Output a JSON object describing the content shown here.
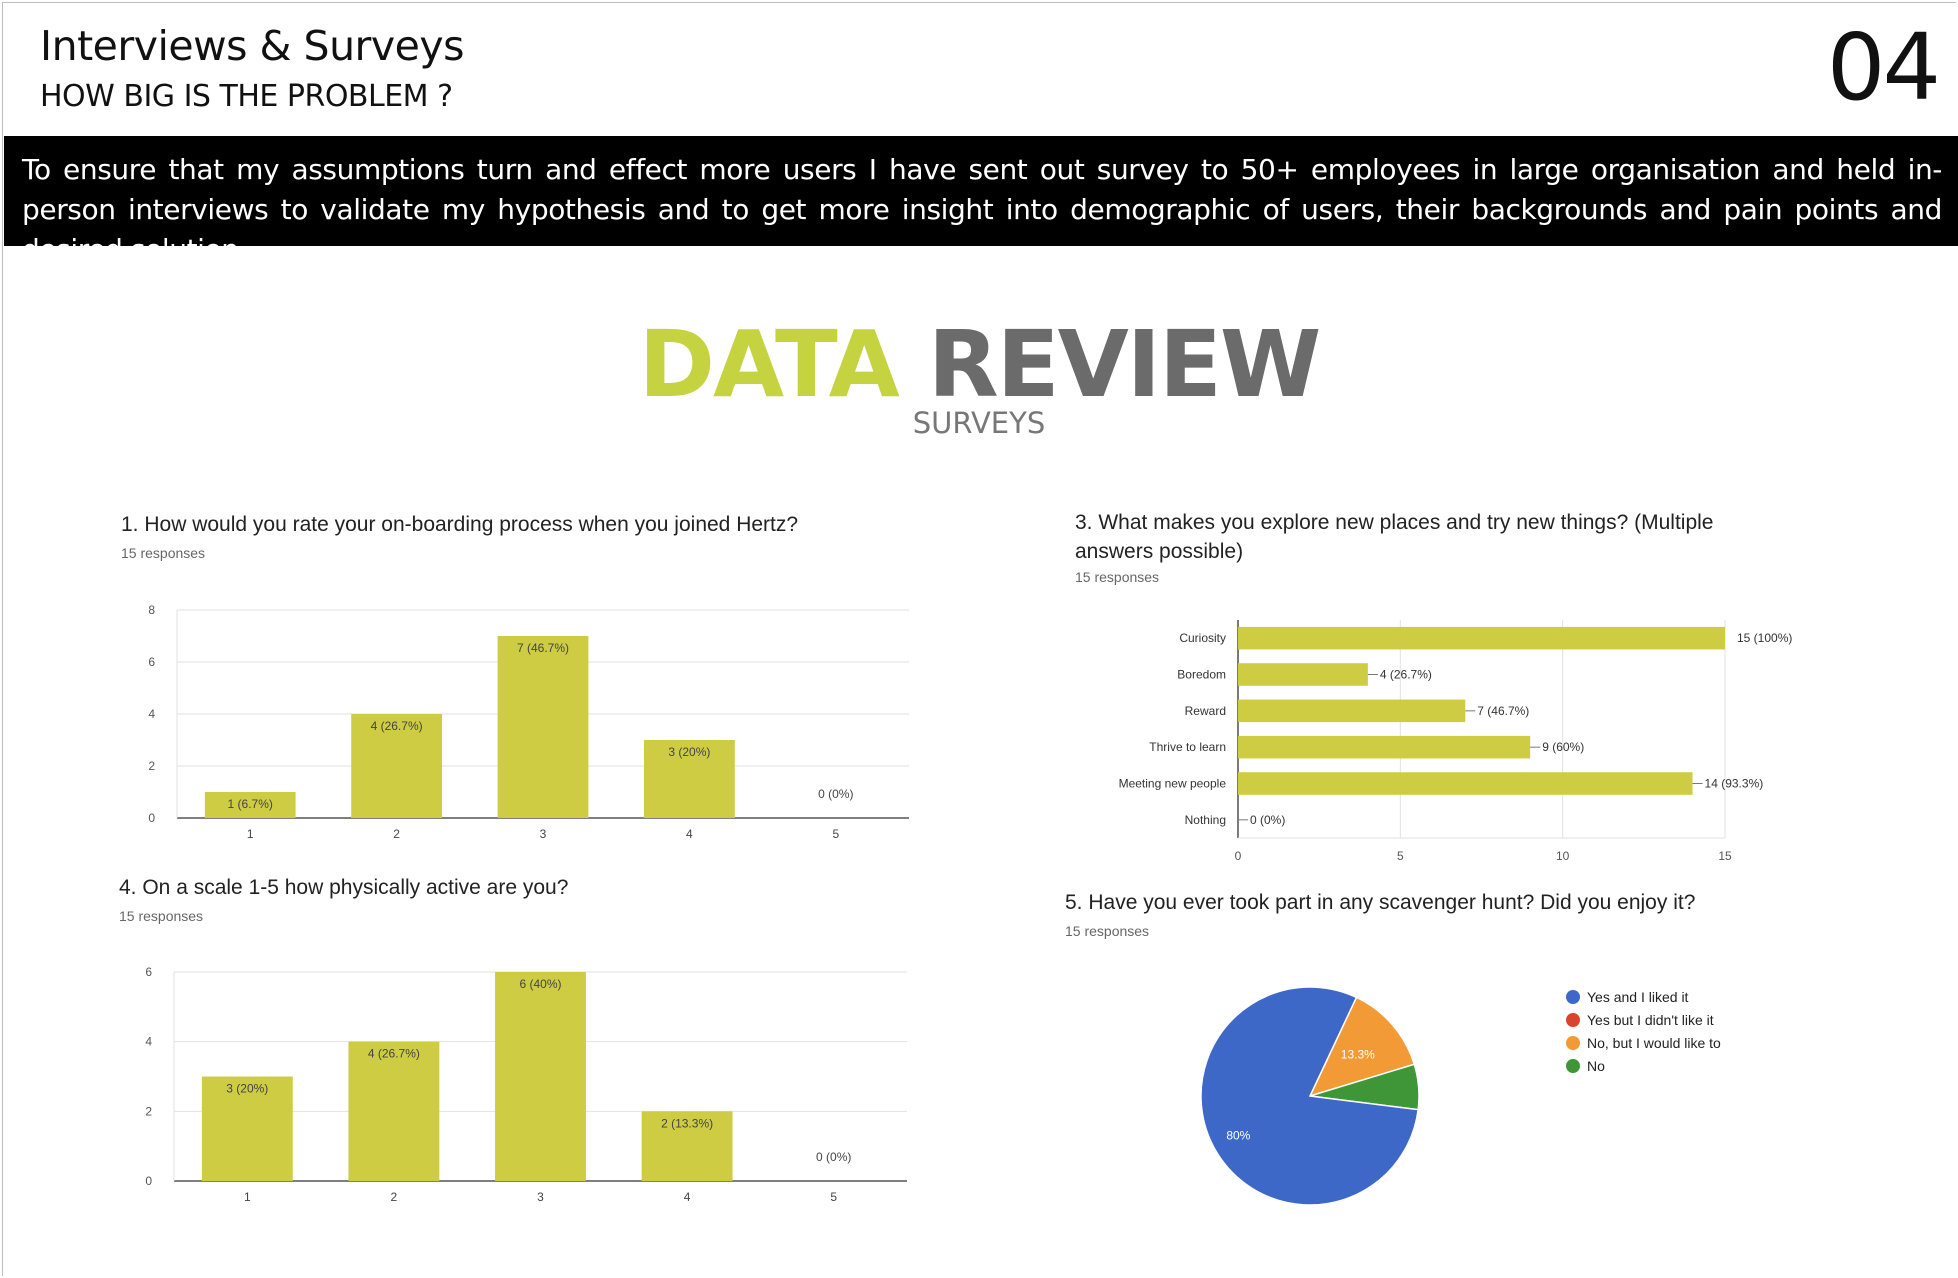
{
  "header": {
    "title": "Interviews & Surveys",
    "subtitle": "HOW BIG IS THE PROBLEM ?",
    "page_number": "04"
  },
  "intro": "To ensure that my assumptions turn and effect more users I have sent out survey to 50+ employees in large organisation and held in-person interviews to validate my hypothesis and to get more insight into demographic of users, their backgrounds and pain points and desired solution.",
  "banner": {
    "word1": "DATA",
    "word2": "REVIEW",
    "subtitle": "SURVEYS",
    "colors": {
      "data": "#c6d341",
      "review": "#6b6b6b"
    }
  },
  "questions": {
    "q1": {
      "title": "1. How would you rate your on-boarding process when you joined Hertz?",
      "responses": "15 responses"
    },
    "q3": {
      "title": "3.  What makes you explore new places and try new things? (Multiple answers possible)",
      "responses": "15 responses"
    },
    "q4": {
      "title": "4. On a scale 1-5 how physically active are you?",
      "responses": "15 responses"
    },
    "q5": {
      "title": "5. Have you ever took part in any scavenger hunt? Did you enjoy it?",
      "responses": "15 responses"
    }
  },
  "chart_data": [
    {
      "id": "q1",
      "type": "bar",
      "categories": [
        "1",
        "2",
        "3",
        "4",
        "5"
      ],
      "values": [
        1,
        4,
        7,
        3,
        0
      ],
      "labels": [
        "1 (6.7%)",
        "4 (26.7%)",
        "7 (46.7%)",
        "3 (20%)",
        "0 (0%)"
      ],
      "ylim": [
        0,
        8
      ],
      "yticks": [
        0,
        2,
        4,
        6,
        8
      ],
      "grid": true,
      "color": "#cdcc42"
    },
    {
      "id": "q3",
      "type": "bar",
      "orientation": "horizontal",
      "categories": [
        "Curiosity",
        "Boredom",
        "Reward",
        "Thrive to learn",
        "Meeting new people",
        "Nothing"
      ],
      "values": [
        15,
        4,
        7,
        9,
        14,
        0
      ],
      "labels": [
        "15 (100%)",
        "4 (26.7%)",
        "7 (46.7%)",
        "9 (60%)",
        "14 (93.3%)",
        "0 (0%)"
      ],
      "xlim": [
        0,
        15
      ],
      "xticks": [
        0,
        5,
        10,
        15
      ],
      "grid": true,
      "color": "#cdcc42"
    },
    {
      "id": "q4",
      "type": "bar",
      "categories": [
        "1",
        "2",
        "3",
        "4",
        "5"
      ],
      "values": [
        3,
        4,
        6,
        2,
        0
      ],
      "labels": [
        "3 (20%)",
        "4 (26.7%)",
        "6 (40%)",
        "2 (13.3%)",
        "0 (0%)"
      ],
      "ylim": [
        0,
        6
      ],
      "yticks": [
        0,
        2,
        4,
        6
      ],
      "grid": true,
      "color": "#cdcc42"
    },
    {
      "id": "q5",
      "type": "pie",
      "slices": [
        {
          "name": "Yes and I liked it",
          "value": 80,
          "label": "80%",
          "color": "#3d68c8"
        },
        {
          "name": "Yes but I didn't like it",
          "value": 0,
          "label": "",
          "color": "#d9452b"
        },
        {
          "name": "No, but I would like to",
          "value": 13.3,
          "label": "13.3%",
          "color": "#f29b36"
        },
        {
          "name": "No",
          "value": 6.7,
          "label": "",
          "color": "#3f9637"
        }
      ],
      "legend": "right"
    }
  ]
}
